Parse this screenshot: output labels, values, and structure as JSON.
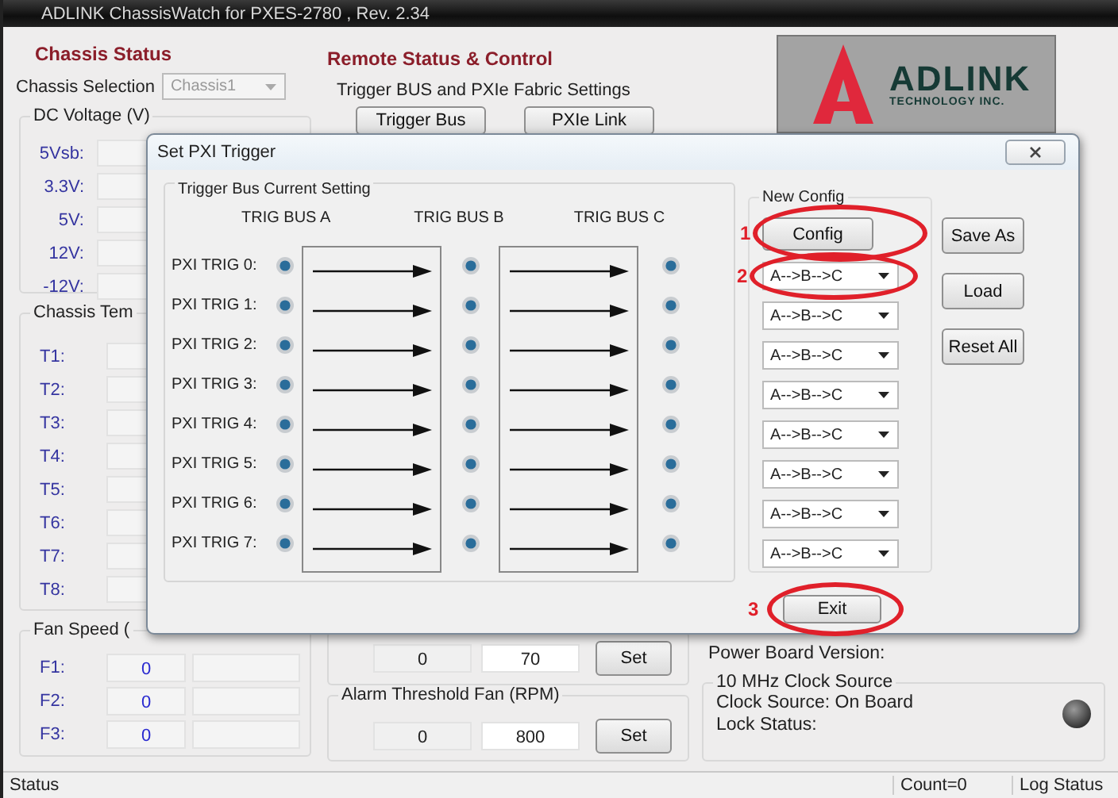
{
  "window": {
    "title": "ADLINK ChassisWatch for PXES-2780 , Rev. 2.34"
  },
  "chassis_status": {
    "heading": "Chassis Status",
    "selection_label": "Chassis Selection",
    "selection_value": "Chassis1",
    "dc_voltage": {
      "title": "DC Voltage (V)",
      "rows": [
        "5Vsb:",
        "3.3V:",
        "5V:",
        "12V:",
        "-12V:"
      ]
    },
    "temperature": {
      "title": "Chassis Tem",
      "rows": [
        "T1:",
        "T2:",
        "T3:",
        "T4:",
        "T5:",
        "T6:",
        "T7:",
        "T8:"
      ]
    },
    "fan_speed": {
      "title": "Fan Speed (",
      "rows": [
        {
          "label": "F1:",
          "value": "0"
        },
        {
          "label": "F2:",
          "value": "0"
        },
        {
          "label": "F3:",
          "value": "0"
        }
      ]
    }
  },
  "remote": {
    "heading": "Remote Status & Control",
    "trigger_group_title": "Trigger BUS and PXIe Fabric Settings",
    "buttons": [
      "Trigger Bus",
      "PXIe Link"
    ],
    "fan_row": {
      "current": "0",
      "input": "70",
      "button": "Set"
    },
    "alarm": {
      "title": "Alarm Threshold Fan (RPM)",
      "current": "0",
      "input": "800",
      "button": "Set"
    }
  },
  "info": {
    "logo": {
      "name": "ADLINK",
      "tagline": "TECHNOLOGY INC."
    },
    "power_board": "Power Board Version:",
    "clock": {
      "title": "10 MHz Clock Source",
      "source": "Clock Source: On Board",
      "lock": "Lock Status:"
    }
  },
  "dialog": {
    "title": "Set PXI Trigger",
    "current": {
      "title": "Trigger Bus Current Setting",
      "buses": [
        "TRIG BUS A",
        "TRIG BUS B",
        "TRIG BUS C"
      ],
      "rows": [
        "PXI TRIG 0:",
        "PXI TRIG 1:",
        "PXI TRIG 2:",
        "PXI TRIG 3:",
        "PXI TRIG 4:",
        "PXI TRIG 5:",
        "PXI TRIG 6:",
        "PXI TRIG 7:"
      ]
    },
    "new_config": {
      "title": "New Config",
      "button": "Config",
      "options": [
        "A-->B-->C",
        "A-->B-->C",
        "A-->B-->C",
        "A-->B-->C",
        "A-->B-->C",
        "A-->B-->C",
        "A-->B-->C",
        "A-->B-->C"
      ]
    },
    "side_buttons": [
      "Save As",
      "Load",
      "Reset All"
    ],
    "exit": "Exit"
  },
  "annotations": [
    "1",
    "2",
    "3"
  ],
  "status_bar": [
    "Status",
    "Count=0",
    "Log Status"
  ]
}
